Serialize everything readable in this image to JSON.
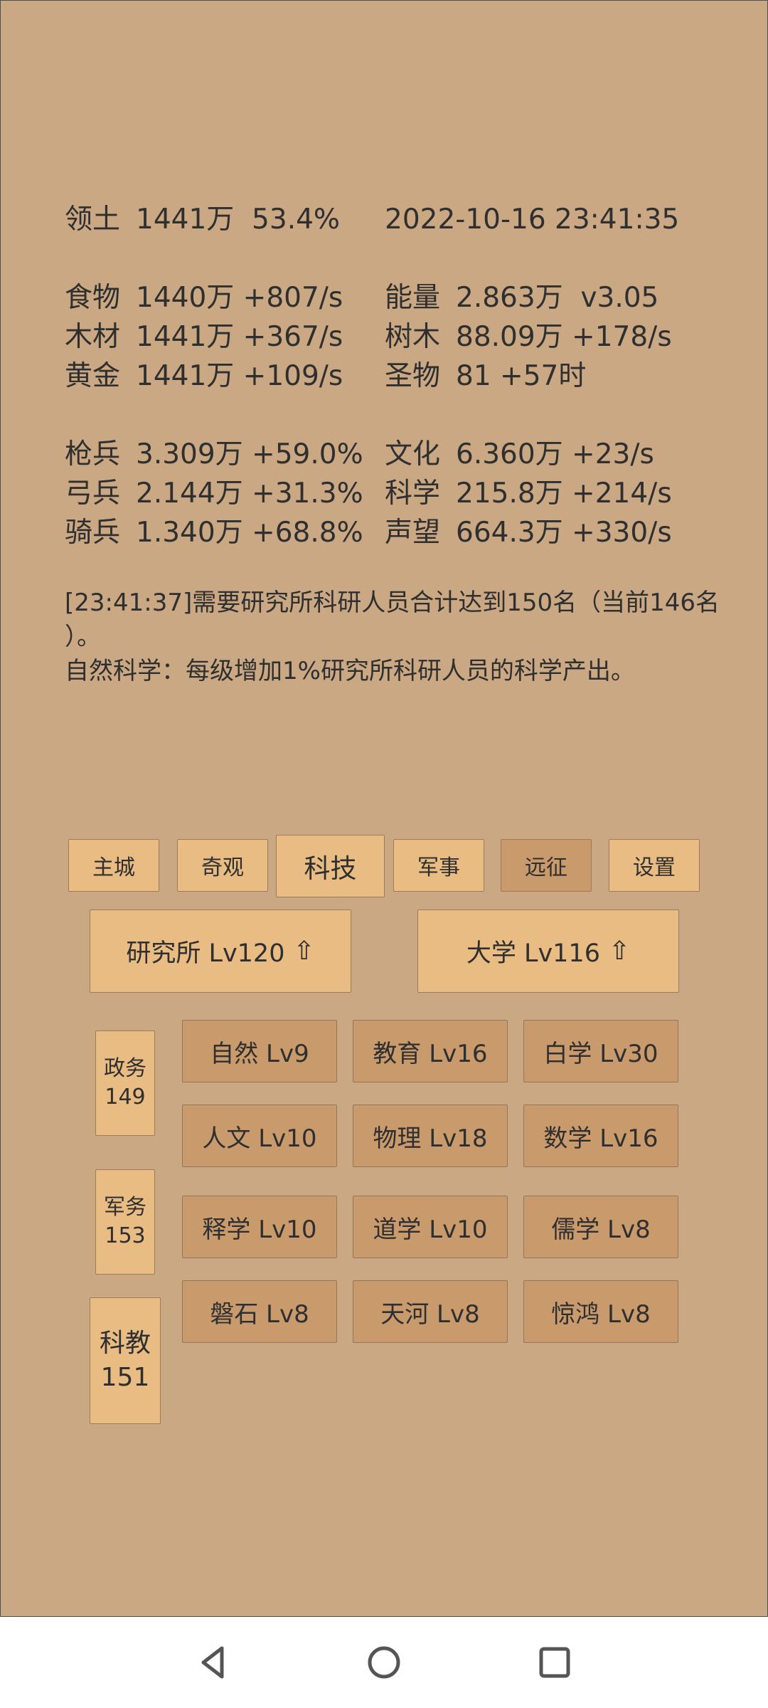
{
  "stats": {
    "territory": {
      "label": "领土",
      "value": "1441万  53.4%"
    },
    "datetime": "2022-10-16 23:41:35",
    "rows_left": [
      {
        "label": "食物",
        "value": "1440万 +807/s"
      },
      {
        "label": "木材",
        "value": "1441万 +367/s"
      },
      {
        "label": "黄金",
        "value": "1441万 +109/s"
      }
    ],
    "rows_right": [
      {
        "label": "能量",
        "value": "2.863万  v3.05"
      },
      {
        "label": "树木",
        "value": "88.09万 +178/s"
      },
      {
        "label": "圣物",
        "value": "81 +57时"
      }
    ],
    "army_left": [
      {
        "label": "枪兵",
        "value": "3.309万 +59.0%"
      },
      {
        "label": "弓兵",
        "value": "2.144万 +31.3%"
      },
      {
        "label": "骑兵",
        "value": "1.340万 +68.8%"
      }
    ],
    "army_right": [
      {
        "label": "文化",
        "value": "6.360万 +23/s"
      },
      {
        "label": "科学",
        "value": "215.8万 +214/s"
      },
      {
        "label": "声望",
        "value": "664.3万 +330/s"
      }
    ]
  },
  "log": {
    "line1": "[23:41:37]需要研究所科研人员合计达到150名（当前146名",
    "line2": "）。",
    "line3": "自然科学：每级增加1%研究所科研人员的科学产出。"
  },
  "tabs": [
    {
      "label": "主城"
    },
    {
      "label": "奇观"
    },
    {
      "label": "科技",
      "selected": true
    },
    {
      "label": "军事"
    },
    {
      "label": "远征"
    },
    {
      "label": "设置"
    }
  ],
  "buildings": [
    {
      "label": "研究所 Lv120",
      "arrow": "⇧"
    },
    {
      "label": "大学 Lv116",
      "arrow": "⇧"
    }
  ],
  "side": [
    {
      "label": "政务",
      "count": "149"
    },
    {
      "label": "军务",
      "count": "153"
    },
    {
      "label": "科教",
      "count": "151",
      "selected": true
    }
  ],
  "techs": [
    "自然 Lv9",
    "教育 Lv16",
    "白学 Lv30",
    "人文 Lv10",
    "物理 Lv18",
    "数学 Lv16",
    "释学 Lv10",
    "道学 Lv10",
    "儒学 Lv8",
    "磐石 Lv8",
    "天河 Lv8",
    "惊鸿 Lv8"
  ],
  "nav": {
    "back": "back-icon",
    "home": "home-icon",
    "recents": "recents-icon"
  },
  "colors": {
    "background": "#c9a883",
    "button": "#e8bc83",
    "button_dim": "#c99a6c",
    "text": "#2f2f2f"
  }
}
